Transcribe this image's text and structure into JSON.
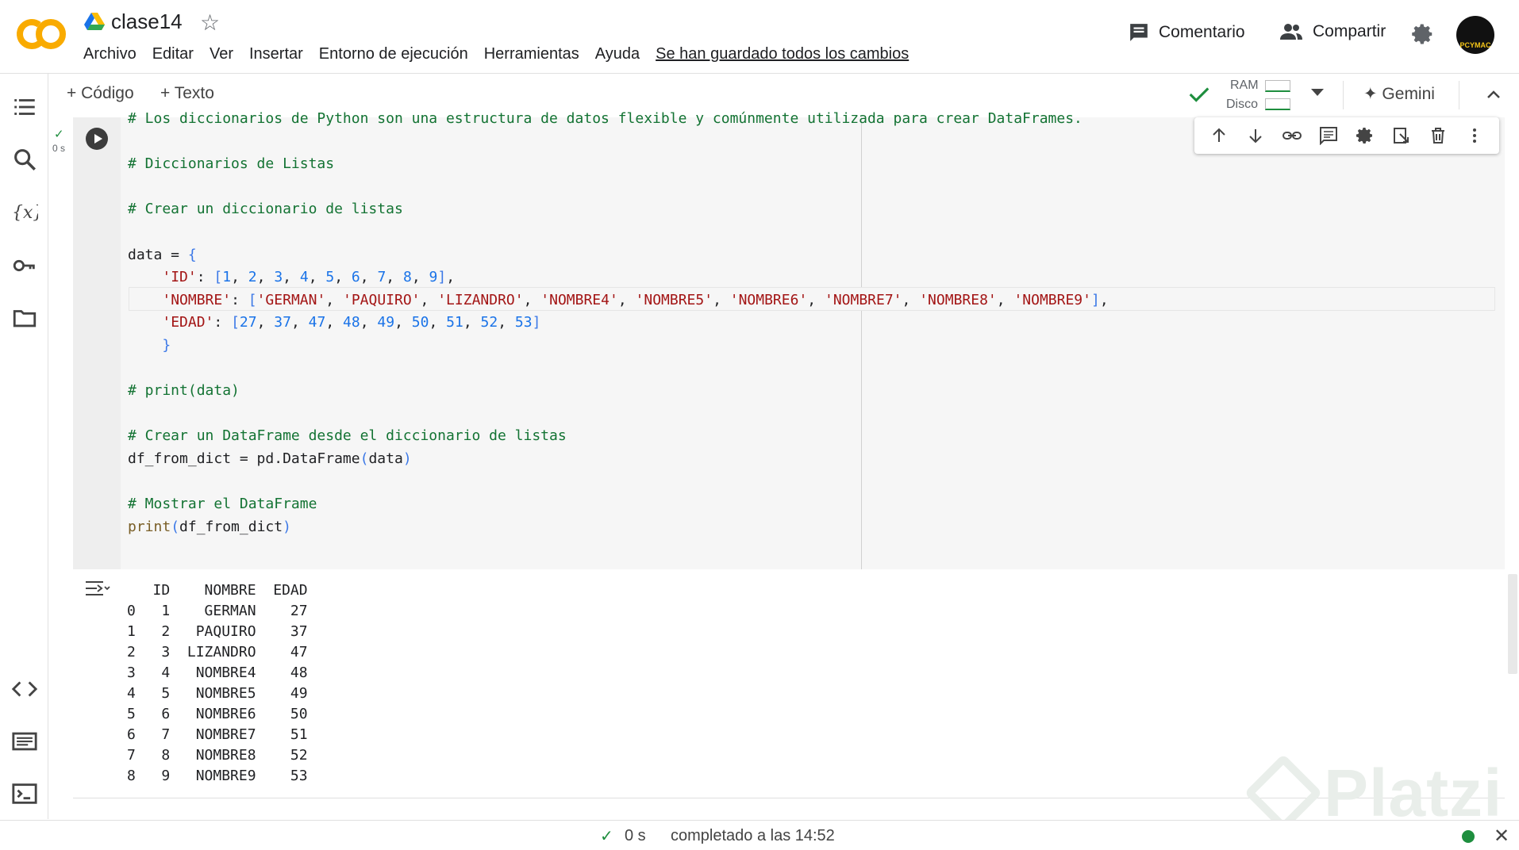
{
  "app": {
    "title": "clase14",
    "save_status": "Se han guardado todos los cambios"
  },
  "menu": [
    "Archivo",
    "Editar",
    "Ver",
    "Insertar",
    "Entorno de ejecución",
    "Herramientas",
    "Ayuda"
  ],
  "header_actions": {
    "comment": "Comentario",
    "share": "Compartir",
    "avatar_text": "PCYMAC"
  },
  "toolbar": {
    "add_code": "+ Código",
    "add_text": "+ Texto",
    "ram": "RAM",
    "disk": "Disco",
    "gemini": "✦ Gemini"
  },
  "cell": {
    "exec_time": "0 s",
    "code_lines": [
      [
        {
          "c": "cm",
          "t": "# Los diccionarios de Python son una estructura de datos flexible y comúnmente utilizada para crear DataFrames."
        }
      ],
      [
        {
          "c": "",
          "t": " "
        }
      ],
      [
        {
          "c": "cm",
          "t": "# Diccionarios de Listas"
        }
      ],
      [
        {
          "c": "",
          "t": " "
        }
      ],
      [
        {
          "c": "cm",
          "t": "# Crear un diccionario de listas"
        }
      ],
      [
        {
          "c": "",
          "t": " "
        }
      ],
      [
        {
          "c": "",
          "t": "data = "
        },
        {
          "c": "br",
          "t": "{"
        }
      ],
      [
        {
          "c": "",
          "t": "    "
        },
        {
          "c": "st",
          "t": "'ID'"
        },
        {
          "c": "",
          "t": ": "
        },
        {
          "c": "br",
          "t": "["
        },
        {
          "c": "nm",
          "t": "1"
        },
        {
          "c": "",
          "t": ", "
        },
        {
          "c": "nm",
          "t": "2"
        },
        {
          "c": "",
          "t": ", "
        },
        {
          "c": "nm",
          "t": "3"
        },
        {
          "c": "",
          "t": ", "
        },
        {
          "c": "nm",
          "t": "4"
        },
        {
          "c": "",
          "t": ", "
        },
        {
          "c": "nm",
          "t": "5"
        },
        {
          "c": "",
          "t": ", "
        },
        {
          "c": "nm",
          "t": "6"
        },
        {
          "c": "",
          "t": ", "
        },
        {
          "c": "nm",
          "t": "7"
        },
        {
          "c": "",
          "t": ", "
        },
        {
          "c": "nm",
          "t": "8"
        },
        {
          "c": "",
          "t": ", "
        },
        {
          "c": "nm",
          "t": "9"
        },
        {
          "c": "br",
          "t": "]"
        },
        {
          "c": "",
          "t": ","
        }
      ],
      [
        {
          "c": "",
          "t": "    "
        },
        {
          "c": "st",
          "t": "'NOMBRE'"
        },
        {
          "c": "",
          "t": ": "
        },
        {
          "c": "br",
          "t": "["
        },
        {
          "c": "st",
          "t": "'GERMAN'"
        },
        {
          "c": "",
          "t": ", "
        },
        {
          "c": "st",
          "t": "'PAQUIRO'"
        },
        {
          "c": "",
          "t": ", "
        },
        {
          "c": "st",
          "t": "'LIZANDRO'"
        },
        {
          "c": "",
          "t": ", "
        },
        {
          "c": "st",
          "t": "'NOMBRE4'"
        },
        {
          "c": "",
          "t": ", "
        },
        {
          "c": "st",
          "t": "'NOMBRE5'"
        },
        {
          "c": "",
          "t": ", "
        },
        {
          "c": "st",
          "t": "'NOMBRE6'"
        },
        {
          "c": "",
          "t": ", "
        },
        {
          "c": "st",
          "t": "'NOMBRE7'"
        },
        {
          "c": "",
          "t": ", "
        },
        {
          "c": "st",
          "t": "'NOMBRE8'"
        },
        {
          "c": "",
          "t": ", "
        },
        {
          "c": "st",
          "t": "'NOMBRE9'"
        },
        {
          "c": "br",
          "t": "]"
        },
        {
          "c": "",
          "t": ","
        }
      ],
      [
        {
          "c": "",
          "t": "    "
        },
        {
          "c": "st",
          "t": "'EDAD'"
        },
        {
          "c": "",
          "t": ": "
        },
        {
          "c": "br",
          "t": "["
        },
        {
          "c": "nm",
          "t": "27"
        },
        {
          "c": "",
          "t": ", "
        },
        {
          "c": "nm",
          "t": "37"
        },
        {
          "c": "",
          "t": ", "
        },
        {
          "c": "nm",
          "t": "47"
        },
        {
          "c": "",
          "t": ", "
        },
        {
          "c": "nm",
          "t": "48"
        },
        {
          "c": "",
          "t": ", "
        },
        {
          "c": "nm",
          "t": "49"
        },
        {
          "c": "",
          "t": ", "
        },
        {
          "c": "nm",
          "t": "50"
        },
        {
          "c": "",
          "t": ", "
        },
        {
          "c": "nm",
          "t": "51"
        },
        {
          "c": "",
          "t": ", "
        },
        {
          "c": "nm",
          "t": "52"
        },
        {
          "c": "",
          "t": ", "
        },
        {
          "c": "nm",
          "t": "53"
        },
        {
          "c": "br",
          "t": "]"
        }
      ],
      [
        {
          "c": "",
          "t": "    "
        },
        {
          "c": "br",
          "t": "}"
        }
      ],
      [
        {
          "c": "",
          "t": " "
        }
      ],
      [
        {
          "c": "cm",
          "t": "# print(data)"
        }
      ],
      [
        {
          "c": "",
          "t": " "
        }
      ],
      [
        {
          "c": "cm",
          "t": "# Crear un DataFrame desde el diccionario de listas"
        }
      ],
      [
        {
          "c": "",
          "t": "df_from_dict = pd.DataFrame"
        },
        {
          "c": "br",
          "t": "("
        },
        {
          "c": "",
          "t": "data"
        },
        {
          "c": "br",
          "t": ")"
        }
      ],
      [
        {
          "c": "",
          "t": " "
        }
      ],
      [
        {
          "c": "cm",
          "t": "# Mostrar el DataFrame"
        }
      ],
      [
        {
          "c": "pr",
          "t": "print"
        },
        {
          "c": "br",
          "t": "("
        },
        {
          "c": "",
          "t": "df_from_dict"
        },
        {
          "c": "br",
          "t": ")"
        }
      ]
    ]
  },
  "output": {
    "lines": [
      "   ID    NOMBRE  EDAD",
      "0   1    GERMAN    27",
      "1   2   PAQUIRO    37",
      "2   3  LIZANDRO    47",
      "3   4   NOMBRE4    48",
      "4   5   NOMBRE5    49",
      "5   6   NOMBRE6    50",
      "6   7   NOMBRE7    51",
      "7   8   NOMBRE8    52",
      "8   9   NOMBRE9    53"
    ]
  },
  "status": {
    "time": "0 s",
    "message": "completado a las 14:52"
  },
  "watermark": "Platzi",
  "colors": {
    "accent_green": "#1e8e3e",
    "logo_orange": "#f9ab00",
    "logo_dark_orange": "#e8710a"
  }
}
